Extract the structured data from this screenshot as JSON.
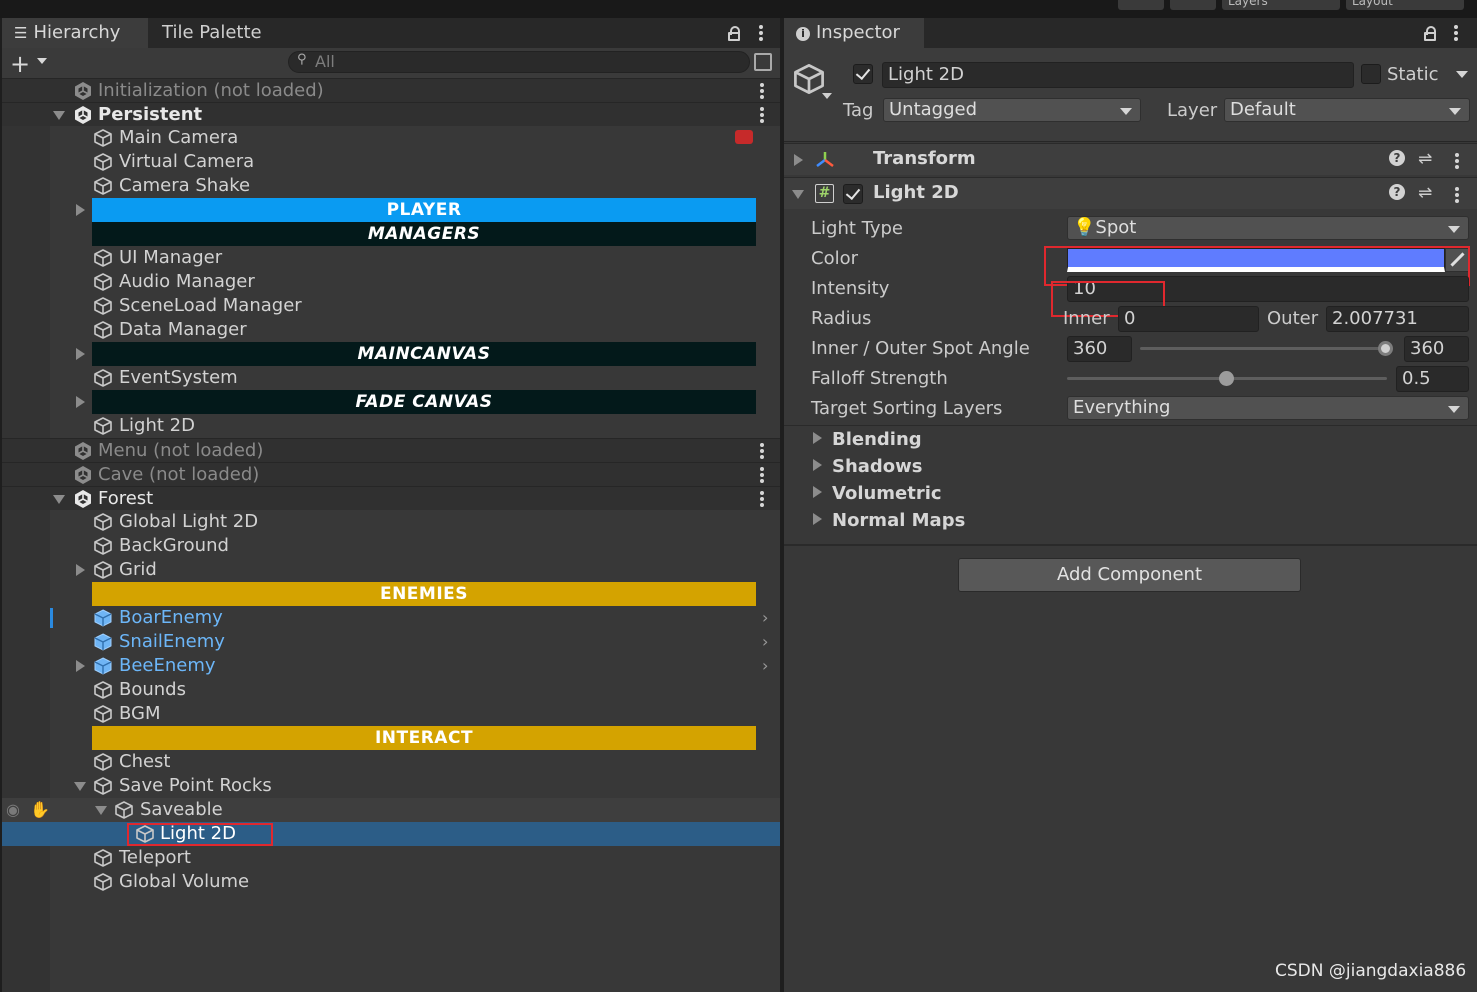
{
  "topbar": {
    "layers_label": "Layers",
    "layout_label": "Layout"
  },
  "hierarchy": {
    "tabs": [
      {
        "label": "Hierarchy"
      },
      {
        "label": "Tile Palette"
      }
    ],
    "search": {
      "placeholder": "All",
      "add_label": "+"
    },
    "rows": [
      {
        "label": "Initialization (not loaded)"
      },
      {
        "label": "Persistent"
      },
      {
        "label": "Main Camera"
      },
      {
        "label": "Virtual Camera"
      },
      {
        "label": "Camera Shake"
      },
      {
        "label": "PLAYER"
      },
      {
        "label": "MANAGERS"
      },
      {
        "label": "UI Manager"
      },
      {
        "label": "Audio Manager"
      },
      {
        "label": "SceneLoad Manager"
      },
      {
        "label": "Data Manager"
      },
      {
        "label": "MAINCANVAS"
      },
      {
        "label": "EventSystem"
      },
      {
        "label": "FADE CANVAS"
      },
      {
        "label": "Light 2D"
      },
      {
        "label": "Menu (not loaded)"
      },
      {
        "label": "Cave (not loaded)"
      },
      {
        "label": "Forest"
      },
      {
        "label": "Global Light 2D"
      },
      {
        "label": "BackGround"
      },
      {
        "label": "Grid"
      },
      {
        "label": "ENEMIES"
      },
      {
        "label": "BoarEnemy"
      },
      {
        "label": "SnailEnemy"
      },
      {
        "label": "BeeEnemy"
      },
      {
        "label": "Bounds"
      },
      {
        "label": "BGM"
      },
      {
        "label": "INTERACT"
      },
      {
        "label": "Chest"
      },
      {
        "label": "Save Point Rocks"
      },
      {
        "label": "Saveable"
      },
      {
        "label": "Light 2D"
      },
      {
        "label": "Teleport"
      },
      {
        "label": "Global Volume"
      }
    ]
  },
  "colors": {
    "player_header": "#0a9bf2",
    "dark_header": "#03191a",
    "enemies_header": "#d4a300",
    "selection": "#2c5d87",
    "prefab_text": "#6cb6f8",
    "light_color_swatch": "#5f7cff",
    "highlight_red": "#e0282e"
  },
  "inspector": {
    "tab_label": "Inspector",
    "object_name": "Light 2D",
    "static_label": "Static",
    "tag_label": "Tag",
    "tag_value": "Untagged",
    "layer_label": "Layer",
    "layer_value": "Default",
    "transform_label": "Transform",
    "light2d_label": "Light 2D",
    "props": {
      "light_type_label": "Light Type",
      "light_type_value": "Spot",
      "color_label": "Color",
      "intensity_label": "Intensity",
      "intensity_value": "10",
      "radius_label": "Radius",
      "inner_label": "Inner",
      "inner_value": "0",
      "outer_label": "Outer",
      "outer_value": "2.007731",
      "spot_angle_label": "Inner / Outer Spot Angle",
      "spot_inner_value": "360",
      "spot_outer_value": "360",
      "falloff_label": "Falloff Strength",
      "falloff_value": "0.5",
      "falloff_fraction": 0.5,
      "sorting_label": "Target Sorting Layers",
      "sorting_value": "Everything"
    },
    "foldouts": [
      {
        "label": "Blending"
      },
      {
        "label": "Shadows"
      },
      {
        "label": "Volumetric"
      },
      {
        "label": "Normal Maps"
      }
    ],
    "add_component_label": "Add Component"
  },
  "watermark": "CSDN @jiangdaxia886"
}
